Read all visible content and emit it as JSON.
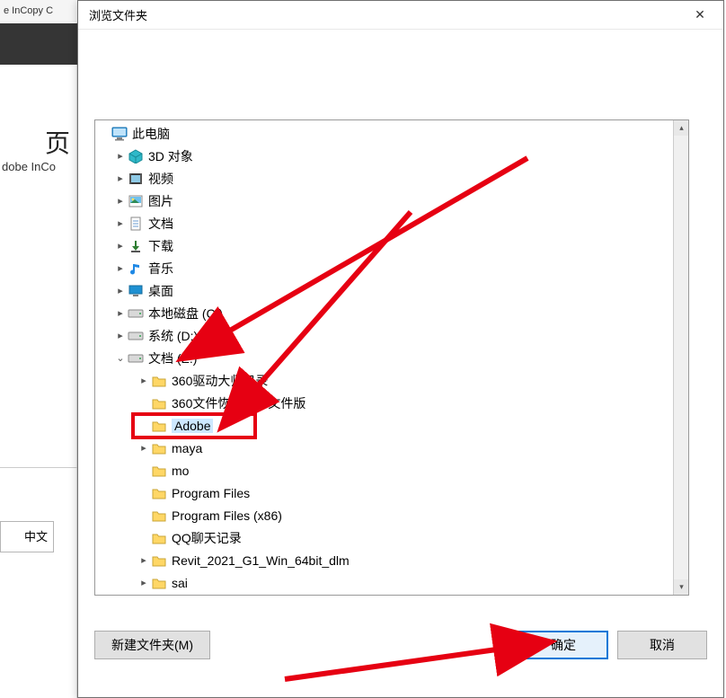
{
  "bg": {
    "app_title_fragment": "e InCopy C",
    "app_name_fragment": "dobe InCo",
    "big_char": "页",
    "lang_fragment": "中文"
  },
  "dialog": {
    "title": "浏览文件夹",
    "close_glyph": "✕"
  },
  "tree": {
    "root": "此电脑",
    "items_l1": [
      "3D 对象",
      "视频",
      "图片",
      "文档",
      "下载",
      "音乐",
      "桌面",
      "本地磁盘 (C:)",
      "系统 (D:)",
      "文档 (E:)"
    ],
    "items_l2": [
      "360驱动大师目录",
      "360文件恢复机单文件版",
      "Adobe",
      "maya",
      "mo",
      "Program Files",
      "Program Files (x86)",
      "QQ聊天记录",
      "Revit_2021_G1_Win_64bit_dlm",
      "sai"
    ],
    "selected_l2_index": 2,
    "expanded_l1_index": 9
  },
  "buttons": {
    "new_folder": "新建文件夹(M)",
    "ok": "确定",
    "cancel": "取消"
  },
  "annotations": {
    "color": "#e60012"
  }
}
